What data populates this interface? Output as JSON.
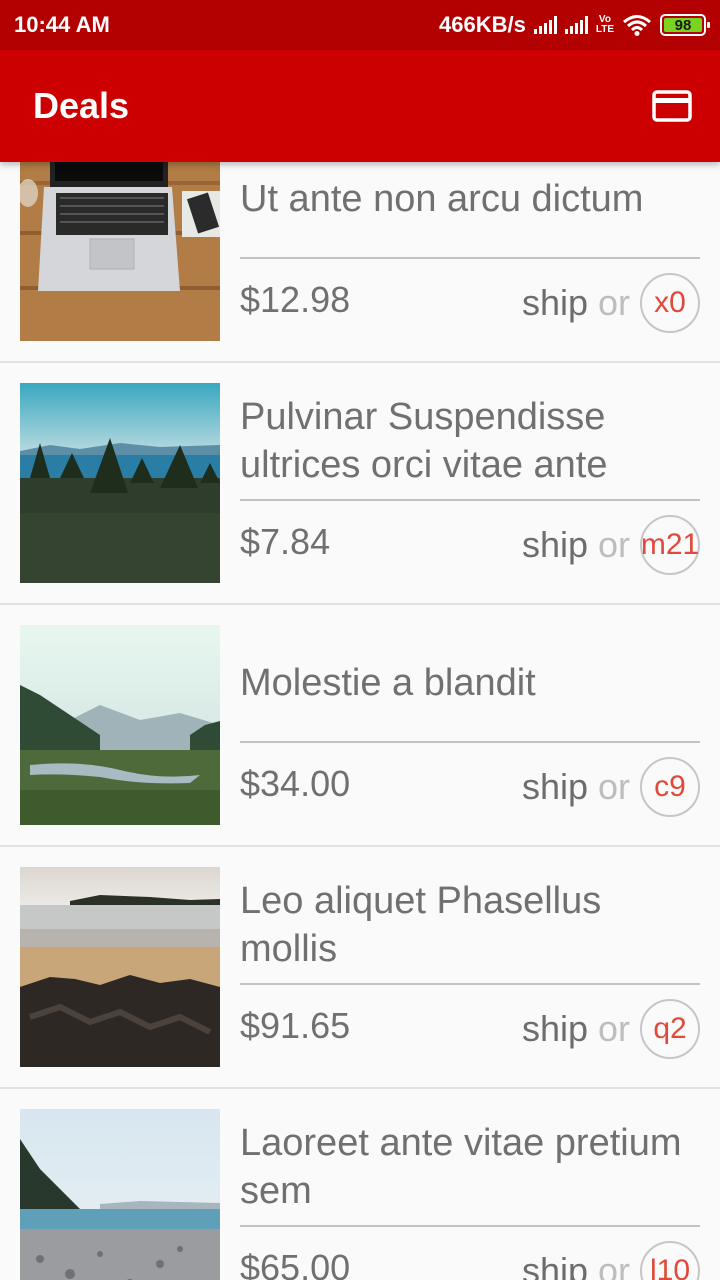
{
  "status_bar": {
    "time": "10:44 AM",
    "speed": "466KB/s",
    "volte_top": "Vo",
    "volte_bottom": "LTE",
    "battery": "98"
  },
  "app_bar": {
    "title": "Deals",
    "action_icon": "credit-card-icon"
  },
  "deals": [
    {
      "title": "Ut ante non arcu dictum",
      "price": "$12.98",
      "ship": "ship",
      "or": "or",
      "code": "x0",
      "image": "laptop-on-desk"
    },
    {
      "title": "Pulvinar Suspendisse ultrices orci vitae ante",
      "price": "$7.84",
      "ship": "ship",
      "or": "or",
      "code": "m21",
      "image": "forest-and-sea"
    },
    {
      "title": "Molestie a blandit",
      "price": "$34.00",
      "ship": "ship",
      "or": "or",
      "code": "c9",
      "image": "misty-valley"
    },
    {
      "title": "Leo aliquet Phasellus mollis",
      "price": "$91.65",
      "ship": "ship",
      "or": "or",
      "code": "q2",
      "image": "rocky-beach"
    },
    {
      "title": "Laoreet ante vitae pretium sem",
      "price": "$65.00",
      "ship": "ship",
      "or": "or",
      "code": "l10",
      "image": "pebble-shore"
    }
  ],
  "colors": {
    "status_bar": "#b30000",
    "app_bar": "#cc0000",
    "code_text": "#e04a3a"
  }
}
